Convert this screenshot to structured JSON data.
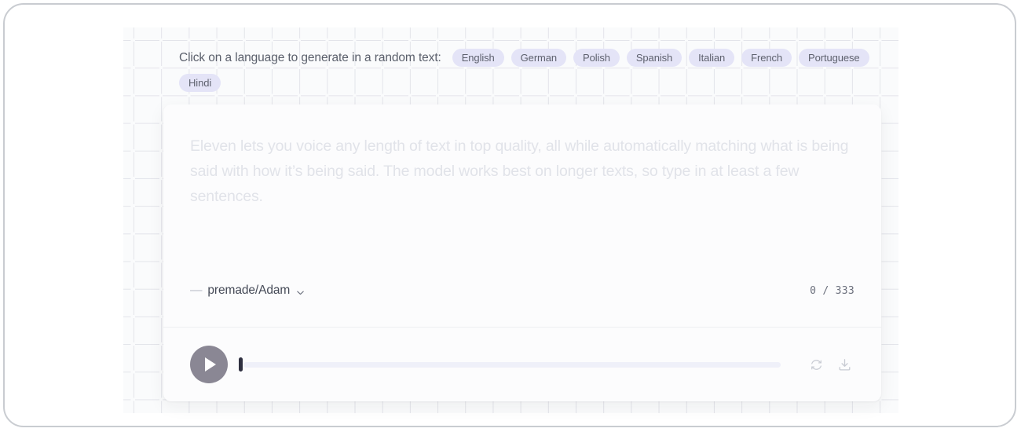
{
  "header": {
    "prompt": "Click on a language to generate in a random text:",
    "languages": [
      {
        "label": "English"
      },
      {
        "label": "German"
      },
      {
        "label": "Polish"
      },
      {
        "label": "Spanish"
      },
      {
        "label": "Italian"
      },
      {
        "label": "French"
      },
      {
        "label": "Portuguese"
      },
      {
        "label": "Hindi"
      }
    ]
  },
  "editor": {
    "value": "",
    "placeholder": "Eleven lets you voice any length of text in top quality, all while automatically matching what is being said with how it’s being said. The model works best on longer texts, so type in at least a few sentences.",
    "voice": {
      "prefix": "—",
      "label": "premade/Adam",
      "chevron_icon": "chevron-down-icon"
    },
    "counter": "0 / 333",
    "counter_current": "0",
    "counter_max": "333"
  },
  "player": {
    "play_icon": "play-icon",
    "play_label": "Play",
    "progress_percent": "0",
    "regenerate_icon": "refresh-icon",
    "download_icon": "download-icon"
  },
  "colors": {
    "chip_bg": "#e4e4f7",
    "chip_text": "#5e616e",
    "placeholder": "#e1e3e9",
    "play_button": "#8a8794",
    "track": "#eff0f9",
    "playhead": "#2f3040",
    "panel_bg": "#fafbfc",
    "card_bg": "#fcfcfd"
  }
}
